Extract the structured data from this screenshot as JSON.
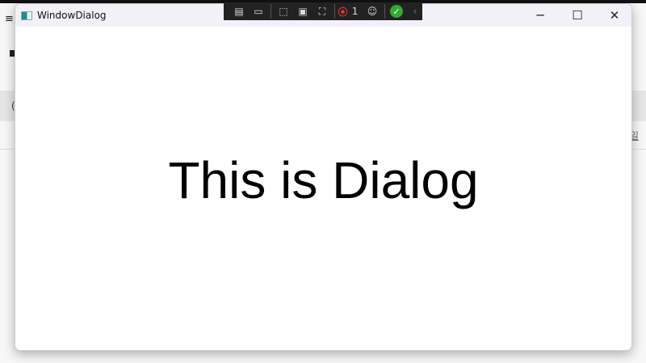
{
  "window": {
    "title": "WindowDialog",
    "message": "This is Dialog"
  },
  "background_app": {
    "menu_icon": "hamburger-icon",
    "partial_text": "일"
  },
  "debug_toolbar": {
    "error_count": "1",
    "icons": [
      "live-visual-tree-icon",
      "video-icon",
      "select-element-icon",
      "display-layout-adorners-icon",
      "track-focus-icon",
      "binding-failures-icon",
      "accessibility-icon",
      "hot-reload-ok-icon",
      "collapse-icon"
    ]
  }
}
